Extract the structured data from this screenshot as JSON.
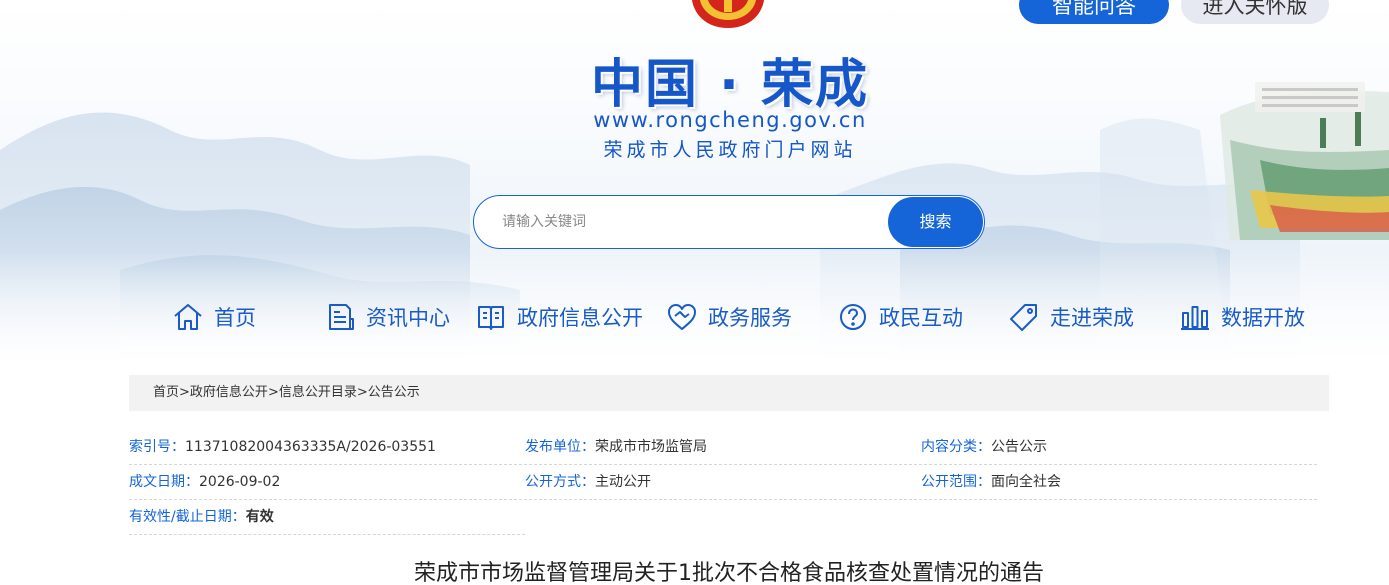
{
  "header": {
    "ai_button": "智能问答",
    "care_button": "进入关怀版",
    "site_title": "中国 · 荣成",
    "site_url": "www.rongcheng.gov.cn",
    "site_subtitle": "荣成市人民政府门户网站"
  },
  "search": {
    "placeholder": "请输入关键词",
    "value": "",
    "button": "搜索"
  },
  "nav": {
    "items": [
      {
        "label": "首页",
        "icon": "home-icon"
      },
      {
        "label": "资讯中心",
        "icon": "news-icon"
      },
      {
        "label": "政府信息公开",
        "icon": "book-icon"
      },
      {
        "label": "政务服务",
        "icon": "handshake-icon"
      },
      {
        "label": "政民互动",
        "icon": "question-icon"
      },
      {
        "label": "走进荣成",
        "icon": "tag-icon"
      },
      {
        "label": "数据开放",
        "icon": "bar-chart-icon"
      }
    ]
  },
  "breadcrumb": {
    "items": [
      "首页",
      "政府信息公开",
      "信息公开目录",
      "公告公示"
    ],
    "separator": ">"
  },
  "meta": {
    "index_no": {
      "key": "索引号：",
      "value": "11371082004363335A/2026-03551"
    },
    "publisher": {
      "key": "发布单位：",
      "value": "荣成市市场监管局"
    },
    "category": {
      "key": "内容分类：",
      "value": "公告公示"
    },
    "date": {
      "key": "成文日期：",
      "value": "2026-09-02"
    },
    "method": {
      "key": "公开方式：",
      "value": "主动公开"
    },
    "scope": {
      "key": "公开范围：",
      "value": "面向全社会"
    },
    "validity": {
      "key": "有效性/截止日期：",
      "value": "有效"
    }
  },
  "article": {
    "title": "荣成市市场监督管理局关于1批次不合格食品核查处置情况的通告"
  },
  "colors": {
    "primary": "#1565d8",
    "nav_text": "#1a5bc7",
    "breadcrumb_bg": "#f2f2f2"
  }
}
